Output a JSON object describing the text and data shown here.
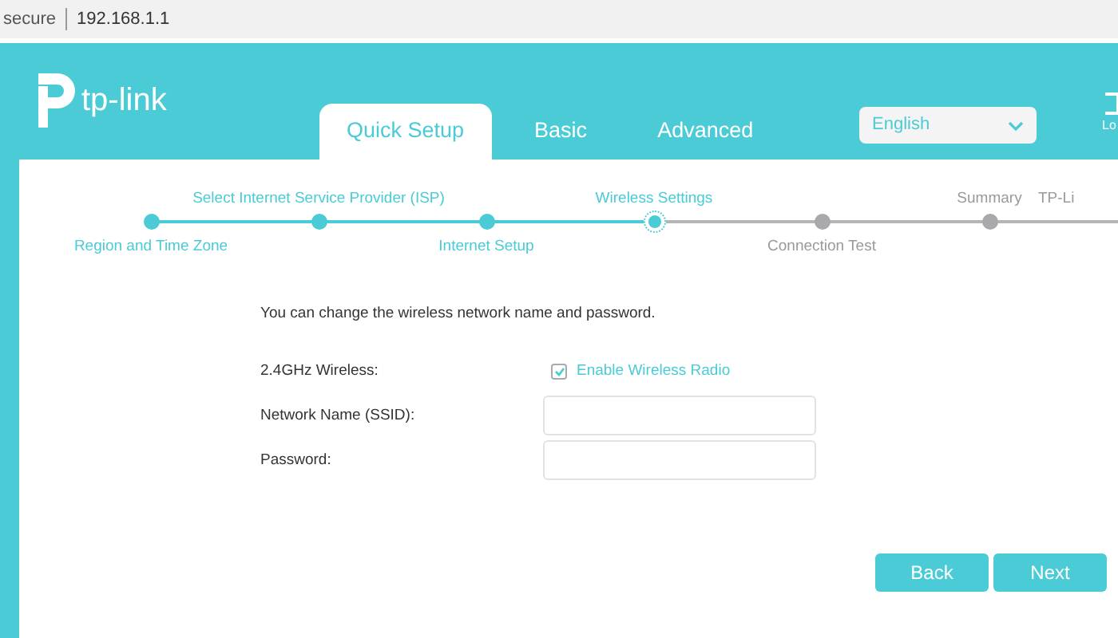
{
  "address_bar": {
    "security": "secure",
    "url": "192.168.1.1"
  },
  "header": {
    "logo_text": "tp-link",
    "tabs": [
      {
        "label": "Quick Setup",
        "selected": true
      },
      {
        "label": "Basic",
        "selected": false
      },
      {
        "label": "Advanced",
        "selected": false
      }
    ],
    "language": "English",
    "logout_label": "Lo"
  },
  "steps": [
    {
      "label": "Region and Time Zone",
      "done": true,
      "current": false
    },
    {
      "label": "Select Internet Service Provider (ISP)",
      "done": true,
      "current": false
    },
    {
      "label": "Internet Setup",
      "done": true,
      "current": false
    },
    {
      "label": "Wireless Settings",
      "done": true,
      "current": true
    },
    {
      "label": "Connection Test",
      "done": false,
      "current": false
    },
    {
      "label": "Summary",
      "done": false,
      "current": false
    },
    {
      "label": "TP-Li",
      "done": false
    }
  ],
  "form": {
    "intro": "You can change the wireless network name and password.",
    "rows": [
      {
        "kind": "checkbox",
        "label": "2.4GHz Wireless:",
        "option": "Enable Wireless Radio",
        "checked": true
      },
      {
        "kind": "input",
        "label": "Network Name (SSID):"
      },
      {
        "kind": "input",
        "label": "Password:"
      }
    ]
  },
  "buttons": [
    "Back",
    "Next"
  ]
}
